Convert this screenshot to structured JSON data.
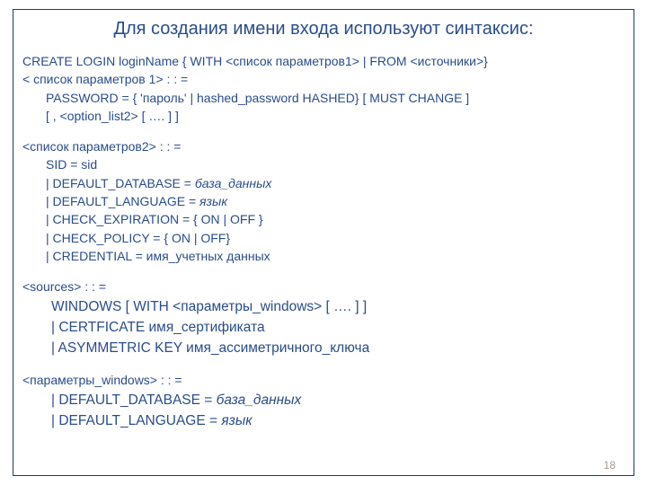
{
  "title": "Для создания имени входа используют синтаксис:",
  "block1": {
    "l1": "CREATE LOGIN loginName { WITH <список параметров1> | FROM <источники>}",
    "l2": "< список параметров 1> : : =",
    "l3": "PASSWORD = { 'пароль' | hashed_password HASHED} [ MUST CHANGE ]",
    "l4": "[ , <option_list2> [ …. ] ]"
  },
  "block2": {
    "l1": "<список параметров2> : : =",
    "l2": "SID = sid",
    "l3_a": "| DEFAULT_DATABASE = ",
    "l3_b": "база_данных",
    "l4_a": "| DEFAULT_LANGUAGE = ",
    "l4_b": "язык",
    "l5": "| CHECK_EXPIRATION = { ON | OFF }",
    "l6": "| CHECK_POLICY = { ON | OFF}",
    "l7": "| CREDENTIAL = имя_учетных данных"
  },
  "block3": {
    "l1": "<sources> : : =",
    "l2": "WINDOWS [ WITH <параметры_windows> [ …. ] ]",
    "l3": "| CERTFICATE имя_сертификата",
    "l4": "| ASYMMETRIC KEY имя_ассиметричного_ключа"
  },
  "block4": {
    "l1": "<параметры_windows> : : =",
    "l2_a": "| DEFAULT_DATABASE = ",
    "l2_b": "база_данных",
    "l3_a": "| DEFAULT_LANGUAGE = ",
    "l3_b": "язык"
  },
  "pageNumber": "18"
}
